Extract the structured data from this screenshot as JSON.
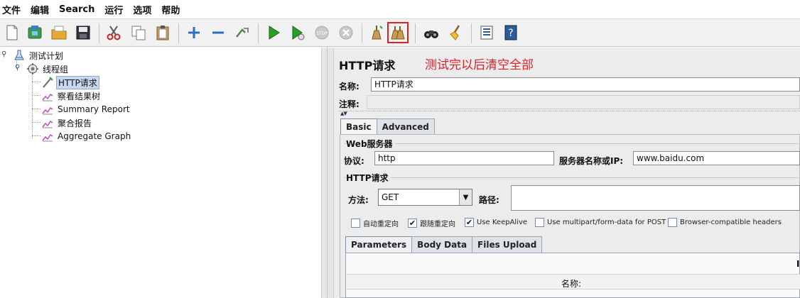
{
  "menubar": {
    "items": [
      "文件",
      "编辑",
      "Search",
      "运行",
      "选项",
      "帮助"
    ]
  },
  "toolbar": {
    "buttons": [
      {
        "name": "new-icon"
      },
      {
        "name": "templates-icon"
      },
      {
        "name": "open-icon"
      },
      {
        "name": "save-icon"
      },
      {
        "name": "cut-icon"
      },
      {
        "name": "copy-icon"
      },
      {
        "name": "paste-icon"
      },
      {
        "name": "expand-icon"
      },
      {
        "name": "collapse-icon"
      },
      {
        "name": "toggle-icon"
      },
      {
        "name": "start-icon"
      },
      {
        "name": "start-no-pause-icon"
      },
      {
        "name": "stop-icon"
      },
      {
        "name": "shutdown-icon"
      },
      {
        "name": "clear-icon"
      },
      {
        "name": "clear-all-icon"
      },
      {
        "name": "search-icon"
      },
      {
        "name": "reset-search-icon"
      },
      {
        "name": "function-helper-icon"
      },
      {
        "name": "help-icon"
      }
    ],
    "highlighted": "clear-all-icon"
  },
  "tree": {
    "nodes": [
      {
        "label": "测试计划",
        "icon": "test-plan-icon",
        "level": 0
      },
      {
        "label": "线程组",
        "icon": "thread-group-icon",
        "level": 1
      },
      {
        "label": "HTTP请求",
        "icon": "sampler-icon",
        "level": 2,
        "selected": true
      },
      {
        "label": "察看结果树",
        "icon": "listener-icon",
        "level": 2
      },
      {
        "label": "Summary Report",
        "icon": "listener-icon",
        "level": 2
      },
      {
        "label": "聚合报告",
        "icon": "listener-icon",
        "level": 2
      },
      {
        "label": "Aggregate Graph",
        "icon": "listener-icon",
        "level": 2
      }
    ]
  },
  "panel": {
    "title": "HTTP请求",
    "annotation": "测试完以后清空全部",
    "name_label": "名称:",
    "name_value": "HTTP请求",
    "comment_label": "注释:",
    "comment_value": "",
    "tabs": [
      "Basic",
      "Advanced"
    ],
    "web_server_group": "Web服务器",
    "protocol_label": "协议:",
    "protocol_value": "http",
    "server_label": "服务器名称或IP:",
    "server_value": "www.baidu.com",
    "http_request_group": "HTTP请求",
    "method_label": "方法:",
    "method_value": "GET",
    "path_label": "路径:",
    "path_value": "",
    "checkboxes": [
      {
        "label": "自动重定向",
        "checked": false
      },
      {
        "label": "跟随重定向",
        "checked": true
      },
      {
        "label": "Use KeepAlive",
        "checked": true
      },
      {
        "label": "Use multipart/form-data for POST",
        "checked": false
      },
      {
        "label": "Browser-compatible headers",
        "checked": false
      }
    ],
    "sub_tabs": [
      "Parameters",
      "Body Data",
      "Files Upload"
    ],
    "params_column": "名称:",
    "params_edge_text": "I"
  },
  "colors": {
    "annotation": "#e0202a",
    "highlight_border": "#e02020",
    "selection": "#c8d8f0"
  }
}
